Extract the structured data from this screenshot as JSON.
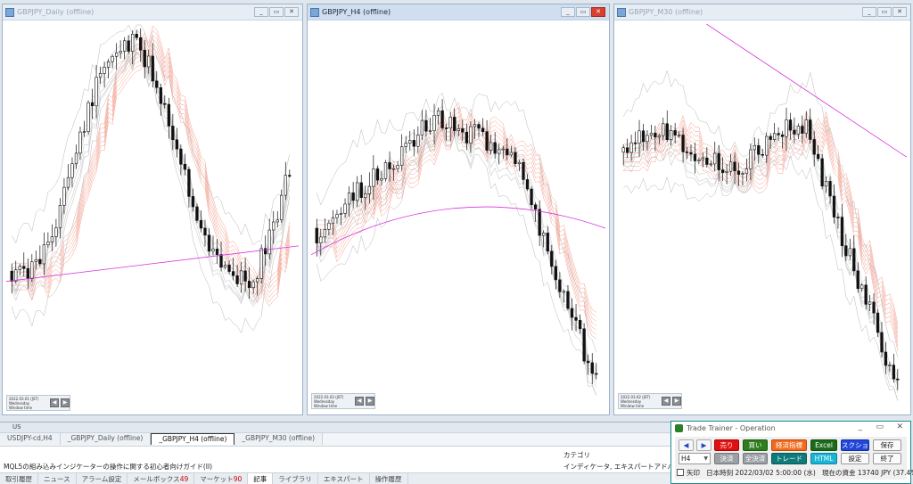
{
  "charts": [
    {
      "title": "GBPJPY_Daily (offline)",
      "info": [
        "2022.03.01 (JST)",
        "Wednesday",
        "Window time"
      ]
    },
    {
      "title": "GBPJPY_H4 (offline)",
      "info": [
        "2022.03.02 (JST)",
        "Wednesday",
        "Window time"
      ]
    },
    {
      "title": "GBPJPY_M30 (offline)",
      "info": [
        "2022.03.02 (JST)",
        "Wednesday",
        "Window time"
      ]
    }
  ],
  "window_buttons": {
    "minimize": "_",
    "restore": "▭",
    "close": "✕"
  },
  "terminal": {
    "title": "US",
    "chart_tabs": [
      "USDJPY-cd,H4",
      "_GBPJPY_Daily (offline)",
      "_GBPJPY_H4 (offline)",
      "_GBPJPY_M30 (offline)"
    ],
    "selected_tab": 2,
    "category_header": "カテゴリ",
    "row_title": "MQL5の組み込みインジケーターの操作に関する初心者向けガイド(II)",
    "row_category": "インディケータ, エキスパートアドバイザー, インデ",
    "bottom_tabs": [
      {
        "label": "取引履歴",
        "badge": ""
      },
      {
        "label": "ニュース",
        "badge": ""
      },
      {
        "label": "アラーム設定",
        "badge": ""
      },
      {
        "label": "メールボックス",
        "badge": "49"
      },
      {
        "label": "マーケット",
        "badge": "90"
      },
      {
        "label": "記事",
        "badge": ""
      },
      {
        "label": "ライブラリ",
        "badge": ""
      },
      {
        "label": "エキスパート",
        "badge": ""
      },
      {
        "label": "操作履歴",
        "badge": ""
      }
    ],
    "selected_bottom_tab": 5
  },
  "trade_trainer": {
    "title": "Trade Trainer - Operation",
    "prev": "◀",
    "next": "▶",
    "sell": "売り",
    "buy": "買い",
    "econ": "経済指標",
    "excel": "Excel",
    "screenshot": "スクショ",
    "save": "保存",
    "timeframe": "H4",
    "settle": "決済",
    "settle_all": "全決済",
    "trend": "トレード",
    "html": "HTML",
    "settings": "設定",
    "exit": "終了",
    "arrow_label": "矢印",
    "japan_time_label": "日本時刻",
    "japan_time": "2022/03/02 5:00:00 (水)",
    "funds_label": "現在の資金",
    "funds": "13740 JPY (37.4%)"
  },
  "colors": {
    "candle": "#111111",
    "ma_red": "#e8553a",
    "ma_gray": "#9a9a9a",
    "band": "#b7b7b7",
    "magenta": "#d733e0"
  }
}
